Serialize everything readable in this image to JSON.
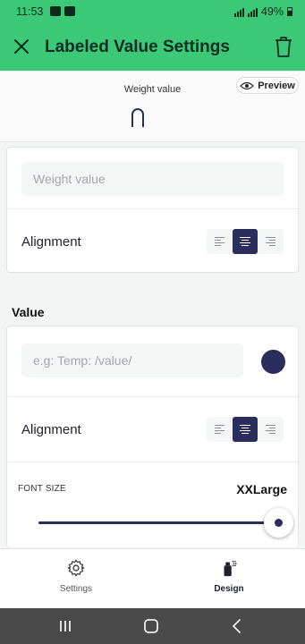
{
  "status": {
    "time": "11:53",
    "battery": "49%"
  },
  "appbar": {
    "title": "Labeled Value Settings",
    "close_icon": "close-icon",
    "trash_icon": "trash-icon"
  },
  "preview": {
    "label": "Weight value",
    "value_symbol": "∩",
    "button_label": "Preview"
  },
  "label_card": {
    "input": {
      "value": "",
      "placeholder": "Weight value"
    },
    "alignment_label": "Alignment",
    "alignment_selected": "center"
  },
  "value_section": {
    "heading": "Value",
    "input": {
      "value": "",
      "placeholder": "e.g: Temp: /value/"
    },
    "color": "#2b2d5c",
    "alignment_label": "Alignment",
    "alignment_selected": "center",
    "font_size_label": "FONT SIZE",
    "font_size_value": "XXLarge",
    "font_size_level": 1.0
  },
  "tabs": [
    {
      "label": "Settings",
      "icon": "gear-icon",
      "active": false
    },
    {
      "label": "Design",
      "icon": "spray-can-icon",
      "active": true
    }
  ],
  "colors": {
    "accent": "#3bc877",
    "primary": "#2b2d5c"
  }
}
